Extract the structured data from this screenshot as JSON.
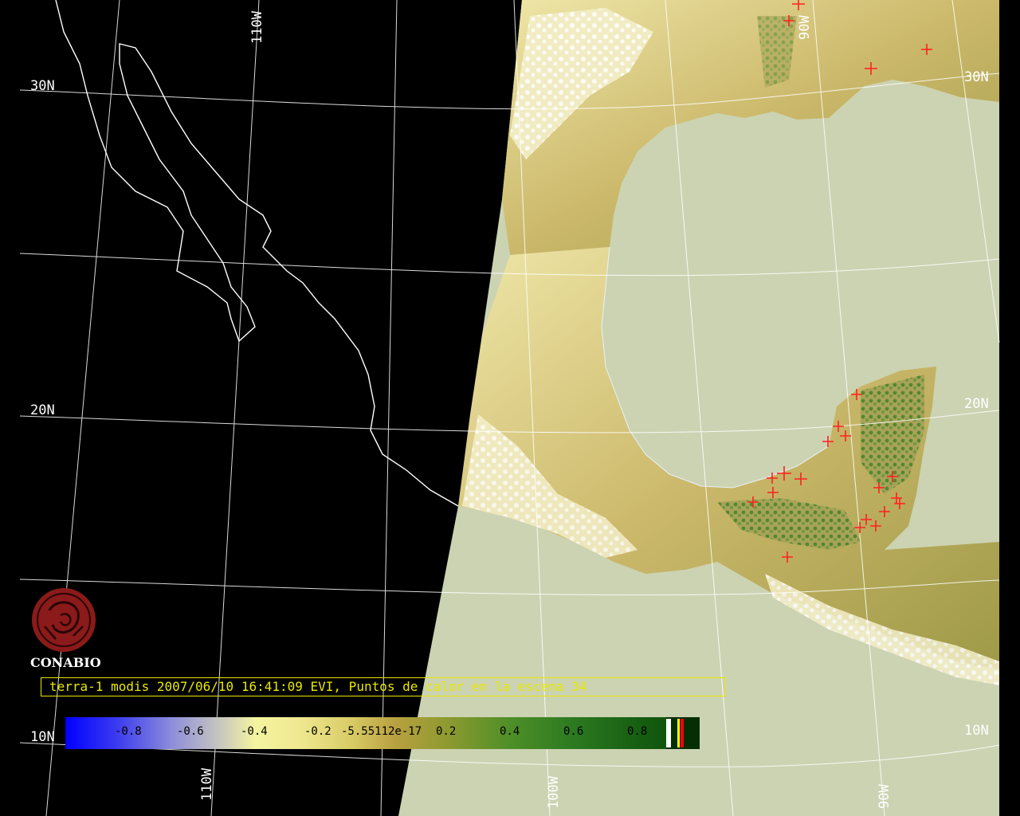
{
  "caption": "terra-1 modis 2007/06/10 16:41:09 EVI, Puntos de calor en la escena 34",
  "logo": {
    "name": "CONABIO",
    "icon": "conabio-emblem-icon",
    "color": "#8b1a1a"
  },
  "grid_labels": {
    "lat_30n_left": "30N",
    "lat_20n_left": "20N",
    "lat_10n_left": "10N",
    "lat_30n_right": "30N",
    "lat_20n_right": "20N",
    "lat_10n_right": "10N",
    "lon_110w_top": "110W",
    "lon_110w_bottom": "110W",
    "lon_100w_bottom": "100W",
    "lon_90w_top": "90W",
    "lon_90w_bottom": "90W"
  },
  "colorbar": {
    "ticks": [
      "-0.8",
      "-0.6",
      "-0.4",
      "-0.2",
      "-5.55112e-17",
      "0.2",
      "0.4",
      "0.6",
      "0.8"
    ],
    "end_strip_colors": [
      "#ffffff",
      "#ffff00",
      "#ff0000"
    ]
  },
  "colors": {
    "ocean": "#ccd3b2",
    "night_side": "#000000",
    "coastline": "#ffffff",
    "hotspot": "#ff2020",
    "vegetation_light": "#e8df98",
    "vegetation_mid": "#b9a858",
    "vegetation_dense": "#3f7a25"
  }
}
